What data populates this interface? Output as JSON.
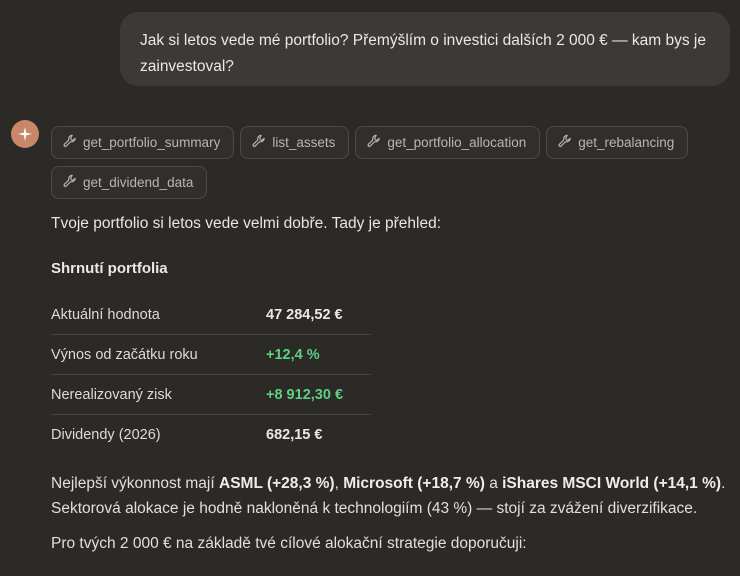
{
  "user_message": "Jak si letos vede mé portfolio? Přemýšlím o investici dalších 2 000 € — kam bys je zainvestoval?",
  "assistant": {
    "avatar_icon": "sparkle-icon",
    "accent_color": "#c8876a",
    "tool_calls": [
      {
        "name": "get_portfolio_summary"
      },
      {
        "name": "list_assets"
      },
      {
        "name": "get_portfolio_allocation"
      },
      {
        "name": "get_rebalancing"
      },
      {
        "name": "get_dividend_data"
      }
    ],
    "intro": "Tvoje portfolio si letos vede velmi dobře. Tady je přehled:",
    "summary_title": "Shrnutí portfolia",
    "summary_rows": [
      {
        "label": "Aktuální hodnota",
        "value": "47 284,52 €"
      },
      {
        "label": "Výnos od začátku roku",
        "value": "+12,4 %"
      },
      {
        "label": "Nerealizovaný zisk",
        "value": "+8 912,30 €"
      },
      {
        "label": "Dividendy (2026)",
        "value": "682,15 €"
      }
    ],
    "positive_color": "#5fcf83",
    "performance": {
      "lead": "Nejlepší výkonnost mají ",
      "asset1": "ASML (+28,3 %)",
      "sep1": ", ",
      "asset2": "Microsoft (+18,7 %)",
      "sep2": " a ",
      "asset3": "iShares MSCI World (+14,1 %)",
      "tail": ". Sektorová alokace je hodně nakloněná k technologiím (43 %) — stojí za zvážení diverzifikace."
    },
    "recommendation_lead": "Pro tvých 2 000 € na základě tvé cílové alokační strategie doporučuji:"
  }
}
